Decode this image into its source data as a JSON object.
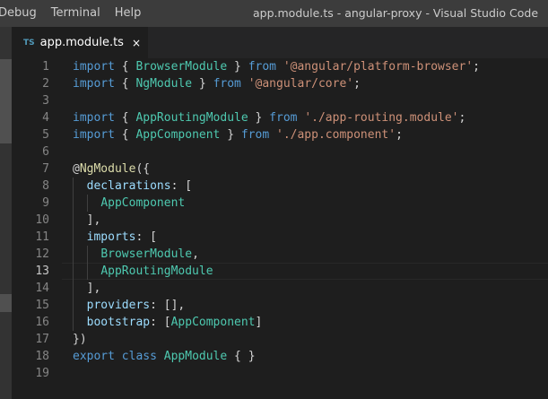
{
  "menu": [
    "Debug",
    "Terminal",
    "Help"
  ],
  "window_title": "app.module.ts - angular-proxy - Visual Studio Code",
  "tab": {
    "badge": "TS",
    "label": "app.module.ts",
    "close": "×"
  },
  "colors": {
    "keyword": "#569cd6",
    "identifier": "#9cdcfe",
    "class": "#4ec9b0",
    "string": "#ce9178",
    "decorator": "#dcdcaa",
    "punctuation": "#d4d4d4"
  },
  "current_line": 13,
  "lines": [
    [
      [
        "kw",
        "import"
      ],
      [
        "pn",
        " { "
      ],
      [
        "cls",
        "BrowserModule"
      ],
      [
        "pn",
        " } "
      ],
      [
        "kw",
        "from"
      ],
      [
        "pn",
        " "
      ],
      [
        "str",
        "'@angular/platform-browser'"
      ],
      [
        "pn",
        ";"
      ]
    ],
    [
      [
        "kw",
        "import"
      ],
      [
        "pn",
        " { "
      ],
      [
        "cls",
        "NgModule"
      ],
      [
        "pn",
        " } "
      ],
      [
        "kw",
        "from"
      ],
      [
        "pn",
        " "
      ],
      [
        "str",
        "'@angular/core'"
      ],
      [
        "pn",
        ";"
      ]
    ],
    [],
    [
      [
        "kw",
        "import"
      ],
      [
        "pn",
        " { "
      ],
      [
        "cls",
        "AppRoutingModule"
      ],
      [
        "pn",
        " } "
      ],
      [
        "kw",
        "from"
      ],
      [
        "pn",
        " "
      ],
      [
        "str",
        "'./app-routing.module'"
      ],
      [
        "pn",
        ";"
      ]
    ],
    [
      [
        "kw",
        "import"
      ],
      [
        "pn",
        " { "
      ],
      [
        "cls",
        "AppComponent"
      ],
      [
        "pn",
        " } "
      ],
      [
        "kw",
        "from"
      ],
      [
        "pn",
        " "
      ],
      [
        "str",
        "'./app.component'"
      ],
      [
        "pn",
        ";"
      ]
    ],
    [],
    [
      [
        "pn",
        "@"
      ],
      [
        "dec",
        "NgModule"
      ],
      [
        "pn",
        "({"
      ]
    ],
    [
      [
        "pn",
        "  "
      ],
      [
        "id",
        "declarations"
      ],
      [
        "pn",
        ": ["
      ]
    ],
    [
      [
        "pn",
        "    "
      ],
      [
        "cls",
        "AppComponent"
      ]
    ],
    [
      [
        "pn",
        "  ],"
      ]
    ],
    [
      [
        "pn",
        "  "
      ],
      [
        "id",
        "imports"
      ],
      [
        "pn",
        ": ["
      ]
    ],
    [
      [
        "pn",
        "    "
      ],
      [
        "cls",
        "BrowserModule"
      ],
      [
        "pn",
        ","
      ]
    ],
    [
      [
        "pn",
        "    "
      ],
      [
        "cls",
        "AppRoutingModule"
      ]
    ],
    [
      [
        "pn",
        "  ],"
      ]
    ],
    [
      [
        "pn",
        "  "
      ],
      [
        "id",
        "providers"
      ],
      [
        "pn",
        ": [],"
      ]
    ],
    [
      [
        "pn",
        "  "
      ],
      [
        "id",
        "bootstrap"
      ],
      [
        "pn",
        ": ["
      ],
      [
        "cls",
        "AppComponent"
      ],
      [
        "pn",
        "]"
      ]
    ],
    [
      [
        "pn",
        "})"
      ]
    ],
    [
      [
        "kw",
        "export"
      ],
      [
        "pn",
        " "
      ],
      [
        "kw",
        "class"
      ],
      [
        "pn",
        " "
      ],
      [
        "cls",
        "AppModule"
      ],
      [
        "pn",
        " { }"
      ]
    ],
    []
  ]
}
